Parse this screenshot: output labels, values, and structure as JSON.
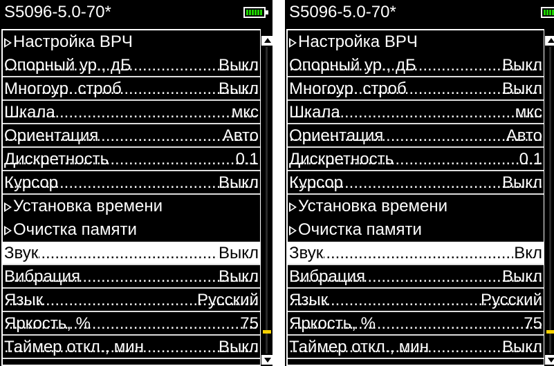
{
  "colors": {
    "background": "#000000",
    "text": "#ffffff",
    "selected_bg": "#ffffff",
    "battery": "#1ed000",
    "scroll_thumb": "#f5d000"
  },
  "left": {
    "title": "S5096-5.0-70*",
    "items": [
      {
        "label": "Настройка ВРЧ",
        "value": "",
        "submenu": true,
        "selected": false
      },
      {
        "label": "Опорный ур., дБ",
        "value": "Выкл",
        "submenu": false,
        "selected": false
      },
      {
        "label": "Многоур. строб",
        "value": "Выкл",
        "submenu": false,
        "selected": false
      },
      {
        "label": "Шкала",
        "value": "мкс",
        "submenu": false,
        "selected": false
      },
      {
        "label": "Ориентация",
        "value": "Авто",
        "submenu": false,
        "selected": false
      },
      {
        "label": "Дискретность",
        "value": "0.1",
        "submenu": false,
        "selected": false
      },
      {
        "label": "Курсор",
        "value": "Выкл",
        "submenu": false,
        "selected": false
      },
      {
        "label": "Установка времени",
        "value": "",
        "submenu": true,
        "selected": false
      },
      {
        "label": "Очистка памяти",
        "value": "",
        "submenu": true,
        "selected": false
      },
      {
        "label": "Звук",
        "value": "Выкл",
        "submenu": false,
        "selected": true
      },
      {
        "label": "Вибрация",
        "value": "Выкл",
        "submenu": false,
        "selected": false
      },
      {
        "label": "Язык",
        "value": "Русский",
        "submenu": false,
        "selected": false
      },
      {
        "label": "Яркость, %",
        "value": "75",
        "submenu": false,
        "selected": false
      },
      {
        "label": "Таймер откл., мин",
        "value": "Выкл",
        "submenu": false,
        "selected": false
      }
    ]
  },
  "right": {
    "title": "S5096-5.0-70*",
    "items": [
      {
        "label": "Настройка ВРЧ",
        "value": "",
        "submenu": true,
        "selected": false
      },
      {
        "label": "Опорный ур., дБ",
        "value": "Выкл",
        "submenu": false,
        "selected": false
      },
      {
        "label": "Многоур. строб",
        "value": "Выкл",
        "submenu": false,
        "selected": false
      },
      {
        "label": "Шкала",
        "value": "мкс",
        "submenu": false,
        "selected": false
      },
      {
        "label": "Ориентация",
        "value": "Авто",
        "submenu": false,
        "selected": false
      },
      {
        "label": "Дискретность",
        "value": "0.1",
        "submenu": false,
        "selected": false
      },
      {
        "label": "Курсор",
        "value": "Выкл",
        "submenu": false,
        "selected": false
      },
      {
        "label": "Установка времени",
        "value": "",
        "submenu": true,
        "selected": false
      },
      {
        "label": "Очистка памяти",
        "value": "",
        "submenu": true,
        "selected": false
      },
      {
        "label": "Звук",
        "value": "Вкл",
        "submenu": false,
        "selected": true
      },
      {
        "label": "Вибрация",
        "value": "Выкл",
        "submenu": false,
        "selected": false
      },
      {
        "label": "Язык",
        "value": "Русский",
        "submenu": false,
        "selected": false
      },
      {
        "label": "Яркость, %",
        "value": "75",
        "submenu": false,
        "selected": false
      },
      {
        "label": "Таймер откл., мин",
        "value": "Выкл",
        "submenu": false,
        "selected": false
      }
    ]
  }
}
